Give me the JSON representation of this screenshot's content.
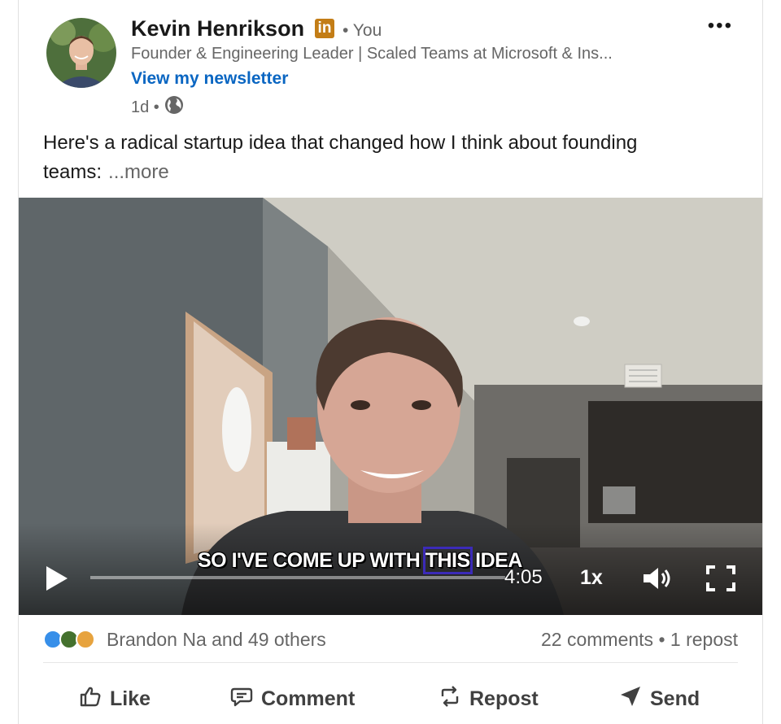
{
  "author": {
    "name": "Kevin Henrikson",
    "badge": "in",
    "relation": "• You",
    "headline": "Founder & Engineering Leader | Scaled Teams at Microsoft & Ins...",
    "newsletter_link": "View my newsletter",
    "time": "1d •"
  },
  "post": {
    "text": "Here's a radical startup idea that changed how I think about founding teams:",
    "more": "...more"
  },
  "video": {
    "caption_before": "SO I'VE COME UP WITH ",
    "caption_highlight": "THIS",
    "caption_after": " IDEA",
    "time": "4:05",
    "speed": "1x",
    "progress": 0.0
  },
  "social": {
    "reactions_text": "Brandon Na and 49 others",
    "comments": "22 comments",
    "separator": "•",
    "reposts": "1 repost"
  },
  "actions": {
    "like": "Like",
    "comment": "Comment",
    "repost": "Repost",
    "send": "Send"
  },
  "icons": {
    "more": "more-options-icon",
    "globe": "globe-icon",
    "play": "play-icon",
    "volume": "volume-icon",
    "fullscreen": "fullscreen-icon",
    "like_reaction": "like-reaction-icon",
    "celebrate_reaction": "celebrate-reaction-icon",
    "insightful_reaction": "insightful-reaction-icon"
  },
  "colors": {
    "link": "#0a66c2",
    "badge": "#c37d16",
    "muted": "#666666"
  }
}
